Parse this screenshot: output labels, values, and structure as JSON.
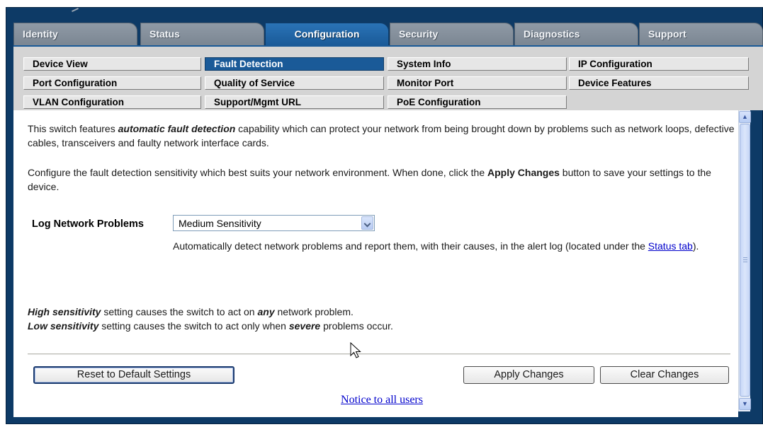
{
  "tabs": [
    {
      "label": "Identity",
      "active": false
    },
    {
      "label": "Status",
      "active": false
    },
    {
      "label": "Configuration",
      "active": true
    },
    {
      "label": "Security",
      "active": false
    },
    {
      "label": "Diagnostics",
      "active": false
    },
    {
      "label": "Support",
      "active": false
    }
  ],
  "subnav": [
    {
      "label": "Device View",
      "active": false
    },
    {
      "label": "Fault Detection",
      "active": true
    },
    {
      "label": "System Info",
      "active": false
    },
    {
      "label": "IP Configuration",
      "active": false
    },
    {
      "label": "Port Configuration",
      "active": false
    },
    {
      "label": "Quality of Service",
      "active": false
    },
    {
      "label": "Monitor Port",
      "active": false
    },
    {
      "label": "Device Features",
      "active": false
    },
    {
      "label": "VLAN Configuration",
      "active": false
    },
    {
      "label": "Support/Mgmt URL",
      "active": false
    },
    {
      "label": "PoE Configuration",
      "active": false
    }
  ],
  "intro": {
    "p1_before": "This switch features ",
    "p1_em": "automatic fault detection",
    "p1_after": " capability which can protect your network from being brought down by problems such as network loops, defective cables, transceivers and faulty network interface cards.",
    "p2_before": "Configure the fault detection sensitivity which best suits your network environment. When done, click the ",
    "p2_strong": "Apply Changes",
    "p2_after": " button to save your settings to the device."
  },
  "log_network_problems": {
    "label": "Log Network Problems",
    "selected": "Medium Sensitivity",
    "help_before": "Automatically detect network problems and report them, with their causes, in the alert log (located under the ",
    "help_link": "Status tab",
    "help_after": ")."
  },
  "sensitivity_notes": {
    "high_em": "High sensitivity",
    "high_mid": " setting causes the switch to act on ",
    "high_em2": "any",
    "high_end": " network problem.",
    "low_em": "Low sensitivity",
    "low_mid": " setting causes the switch to act only when ",
    "low_em2": "severe",
    "low_end": " problems occur."
  },
  "buttons": {
    "reset": "Reset to Default Settings",
    "apply": "Apply Changes",
    "clear": "Clear Changes"
  },
  "footer_link": "Notice to all users",
  "colors": {
    "frame": "#0d3a66",
    "active_tab": "#1a5a98",
    "link": "#0000cc"
  }
}
